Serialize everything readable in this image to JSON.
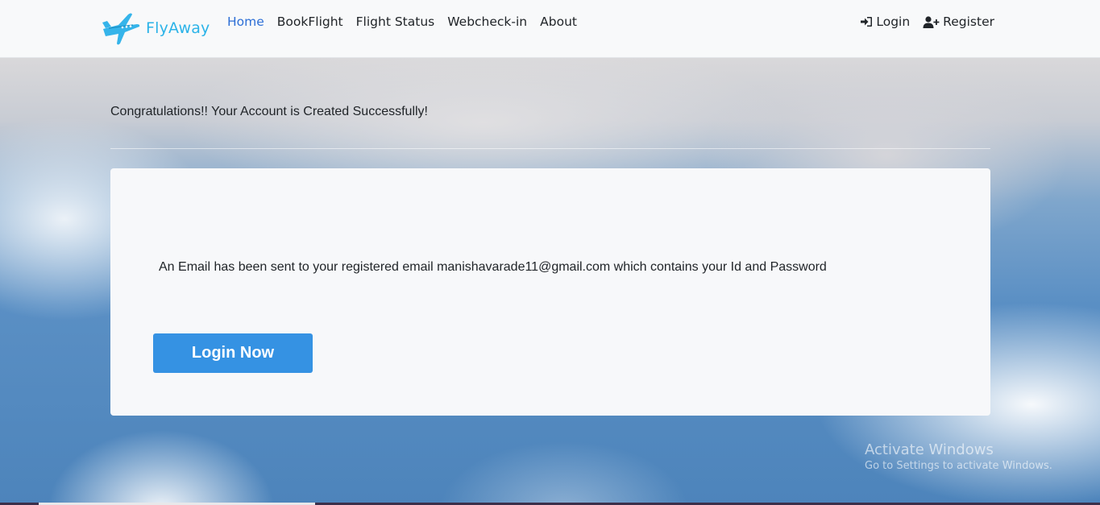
{
  "navbar": {
    "brand": "FlyAway",
    "links": [
      "Home",
      "BookFlight",
      "Flight Status",
      "Webcheck-in",
      "About"
    ],
    "active_link": "Home",
    "login_label": "Login",
    "register_label": "Register"
  },
  "main": {
    "congrats_text": "Congratulations!! Your Account is Created Successfully!",
    "email_message": "An Email has been sent to your registered email manishavarade11@gmail.com which contains your Id and Password",
    "login_button_label": "Login Now"
  },
  "watermark": {
    "title": "Activate Windows",
    "subtitle": "Go to Settings to activate Windows."
  },
  "colors": {
    "brand": "#2bb3e8",
    "active_link": "#2d6fd6",
    "primary_button": "#3592e3",
    "navbar_bg": "#f8f9fa",
    "card_bg": "#f7f8fa"
  },
  "icons": {
    "brand_logo": "airplane-icon",
    "login": "sign-in-icon",
    "register": "user-plus-icon"
  }
}
